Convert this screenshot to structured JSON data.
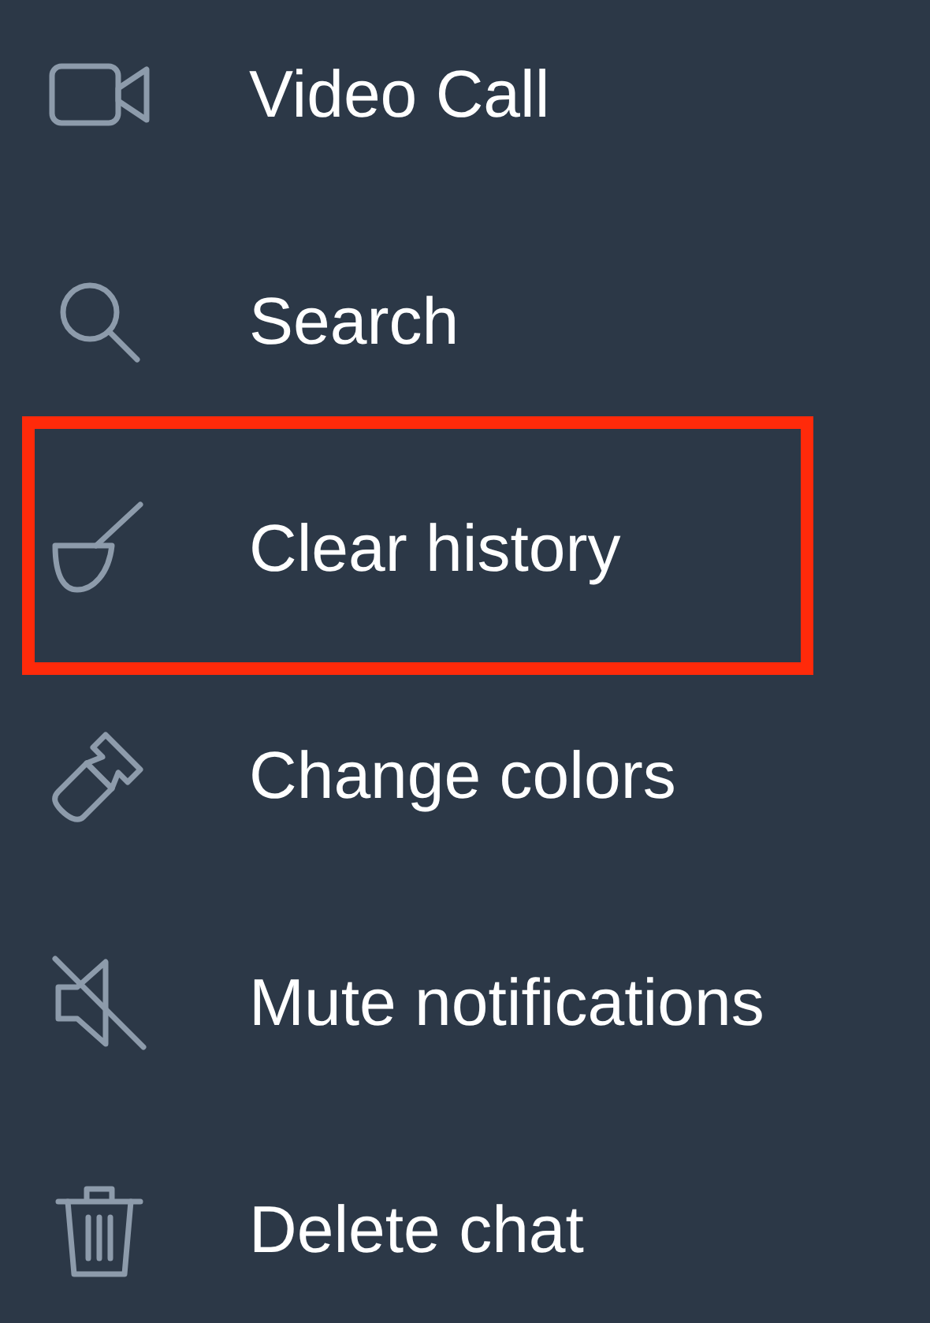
{
  "menu": {
    "items": [
      {
        "kind": "video",
        "label": "Video Call",
        "highlighted": false
      },
      {
        "kind": "search",
        "label": "Search",
        "highlighted": false
      },
      {
        "kind": "clear",
        "label": "Clear history",
        "highlighted": true
      },
      {
        "kind": "colors",
        "label": "Change colors",
        "highlighted": false
      },
      {
        "kind": "mute",
        "label": "Mute notifications",
        "highlighted": false
      },
      {
        "kind": "delete",
        "label": "Delete chat",
        "highlighted": false
      }
    ]
  }
}
